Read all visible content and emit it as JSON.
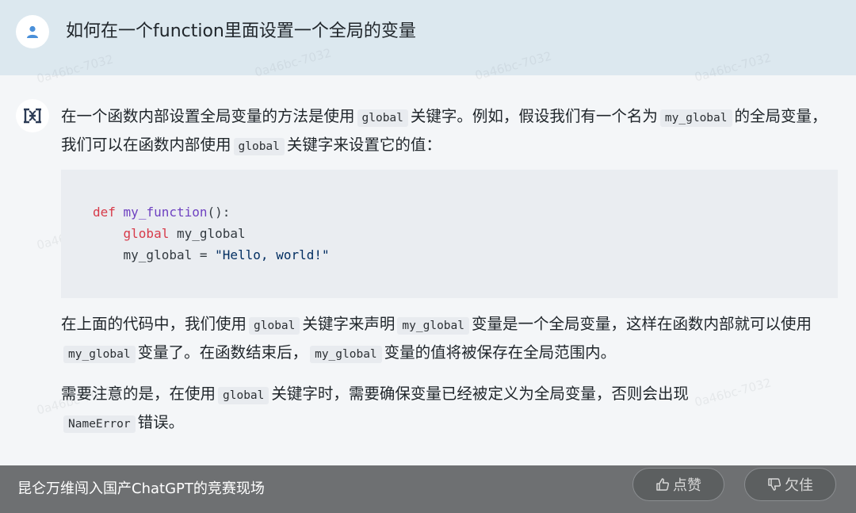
{
  "question": {
    "text": "如何在一个function里面设置一个全局的变量"
  },
  "answer": {
    "p1": {
      "t1": "在一个函数内部设置全局变量的方法是使用",
      "c1": "global",
      "t2": "关键字。例如，假设我们有一个名为",
      "c2": "my_global",
      "t3": "的全局变量，我们可以在函数内部使用",
      "c3": "global",
      "t4": "关键字来设置它的值："
    },
    "code": {
      "line1_kw": "def",
      "line1_fn": "my_function",
      "line1_rest": "():",
      "line2_indent": "    ",
      "line2_kw": "global",
      "line2_rest": " my_global",
      "line3_indent": "    ",
      "line3_rest": "my_global = ",
      "line3_str": "\"Hello, world!\""
    },
    "p2": {
      "t1": "在上面的代码中，我们使用",
      "c1": "global",
      "t2": "关键字来声明",
      "c2": "my_global",
      "t3": "变量是一个全局变量，这样在函数内部就可以使用",
      "c3": "my_global",
      "t4": "变量了。在函数结束后，",
      "c4": "my_global",
      "t5": "变量的值将被保存在全局范围内。"
    },
    "p3": {
      "t1": "需要注意的是，在使用",
      "c1": "global",
      "t2": "关键字时，需要确保变量已经被定义为全局变量，否则会出现",
      "c2": "NameError",
      "t3": "错误。"
    }
  },
  "watermark": "0a46bc-7032",
  "footer": {
    "caption": "昆仑万维闯入国产ChatGPT的竞赛现场",
    "like_label": "点赞",
    "dislike_label": "欠佳"
  },
  "icons": {
    "user": "user-icon",
    "bot": "bot-logo-icon",
    "like": "thumbs-up-icon",
    "dislike": "thumbs-down-icon"
  },
  "colors": {
    "question_bg": "#dce8ef",
    "code_bg": "#eaedf1",
    "keyword": "#d73a49",
    "function": "#6f42c1",
    "string": "#032f62"
  }
}
